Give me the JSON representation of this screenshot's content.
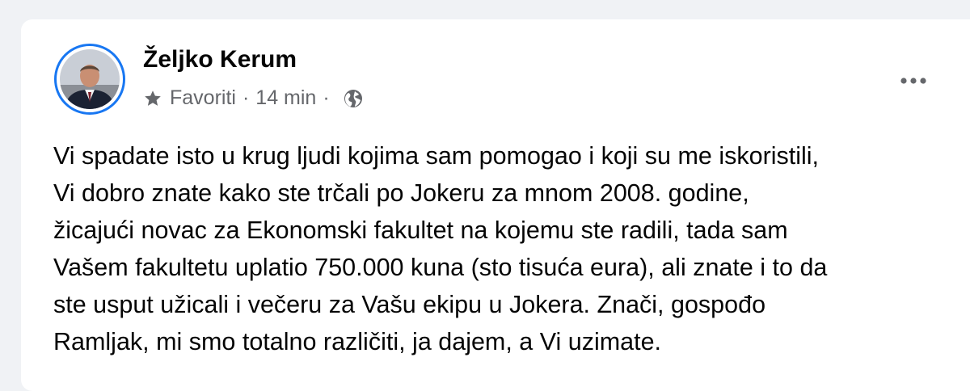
{
  "post": {
    "author": "Željko Kerum",
    "audience": "Favoriti",
    "separator": "·",
    "timestamp": "14 min",
    "icons": {
      "favorite": "star-icon",
      "privacy": "globe-icon",
      "menu": "more-options-icon"
    },
    "accent_color": "#1877f2",
    "text_lines": [
      "Vi spadate isto u krug ljudi kojima sam pomogao i koji su me iskoristili,",
      "Vi dobro znate kako ste trčali po Jokeru za mnom 2008. godine,",
      "žicajući novac za Ekonomski fakultet na kojemu ste radili, tada sam",
      "Vašem fakultetu uplatio 750.000 kuna (sto tisuća eura), ali znate i to da",
      "ste usput užicali i večeru za Vašu ekipu u Jokera. Znači, gospođo",
      "Ramljak, mi smo totalno različiti, ja dajem, a Vi uzimate."
    ]
  }
}
